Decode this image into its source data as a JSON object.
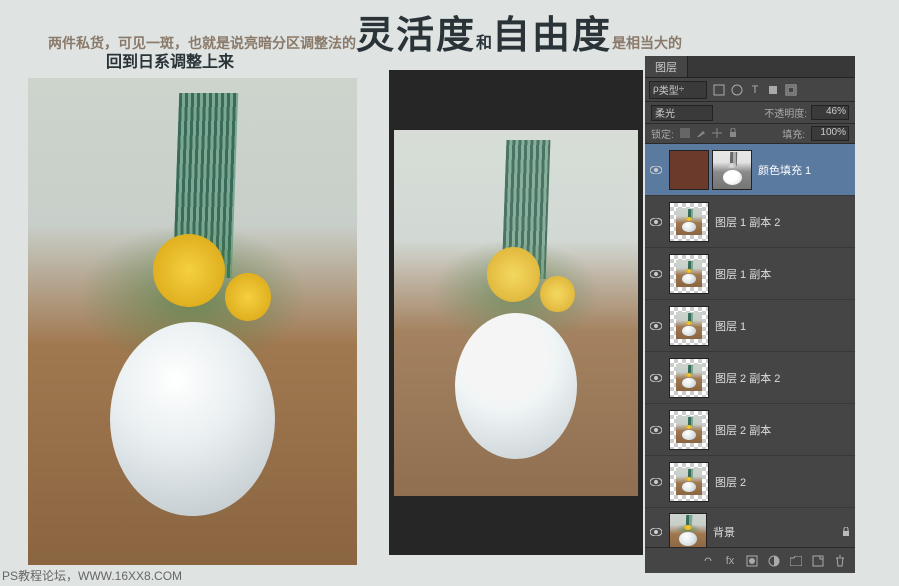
{
  "heading": {
    "prefix": "两件私货，可见一斑，也就是说亮暗分区调整法的",
    "big1": "灵活度",
    "and": "和",
    "big2": "自由度",
    "suffix": "是相当大的"
  },
  "subheading": "回到日系调整上来",
  "panel": {
    "tab": "图层",
    "kind_label": "类型",
    "blend_mode": "柔光",
    "opacity_label": "不透明度:",
    "opacity_value": "46%",
    "lock_label": "锁定:",
    "fill_label": "填充:",
    "fill_value": "100%"
  },
  "layers": [
    {
      "name": "颜色填充 1",
      "type": "fill",
      "selected": true,
      "mask": true
    },
    {
      "name": "图层 1 副本 2",
      "type": "img",
      "trans": true
    },
    {
      "name": "图层 1 副本",
      "type": "img",
      "trans": true
    },
    {
      "name": "图层 1",
      "type": "img",
      "trans": true
    },
    {
      "name": "图层 2 副本 2",
      "type": "img",
      "trans": true
    },
    {
      "name": "图层 2 副本",
      "type": "img",
      "trans": true
    },
    {
      "name": "图层 2",
      "type": "img",
      "trans": true
    },
    {
      "name": "背景",
      "type": "bg",
      "locked": true
    }
  ],
  "footer": "PS教程论坛，WWW.16XX8.COM"
}
